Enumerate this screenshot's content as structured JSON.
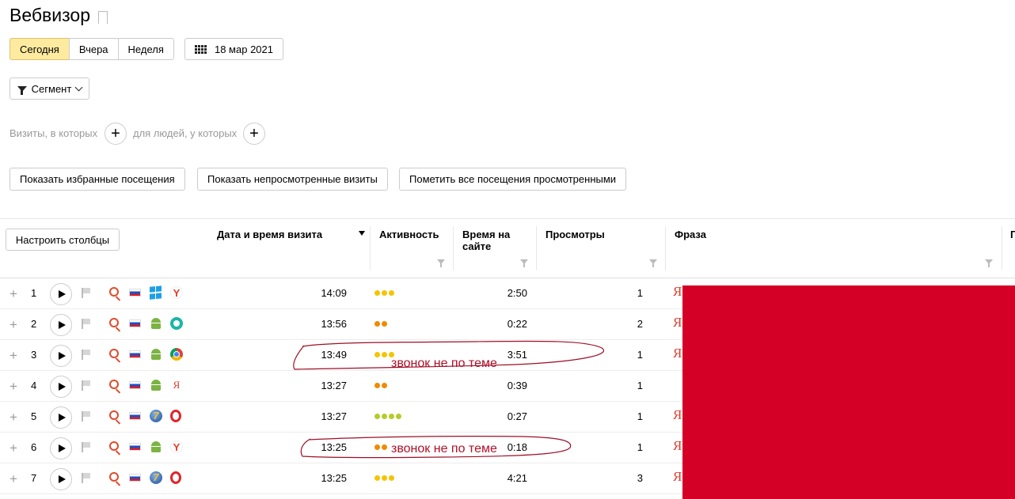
{
  "page": {
    "title": "Вебвизор"
  },
  "period": {
    "options": [
      "Сегодня",
      "Вчера",
      "Неделя"
    ],
    "active_index": 0,
    "date": "18 мар 2021"
  },
  "segment": {
    "label": "Сегмент"
  },
  "conditions": {
    "visits_label": "Визиты, в которых",
    "people_label": "для людей, у которых"
  },
  "actions": {
    "show_favorites": "Показать избранные посещения",
    "show_unviewed": "Показать непросмотренные визиты",
    "mark_all_viewed": "Пометить все посещения просмотренными"
  },
  "table": {
    "configure_columns": "Настроить столбцы",
    "headers": {
      "datetime": "Дата и время визита",
      "activity": "Активность",
      "time_on_site_1": "Время на",
      "time_on_site_2": "сайте",
      "views": "Просмотры",
      "phrase": "Фраза",
      "next_col": "П"
    },
    "rows": [
      {
        "num": "1",
        "os": "windows-icon",
        "browser": "yandex-browser-icon",
        "time": "14:09",
        "activity": 3,
        "activity_color": "#f5c400",
        "duration": "2:50",
        "views": "1",
        "phrase_icon": true
      },
      {
        "num": "2",
        "os": "android-icon",
        "browser": "teal-browser-icon",
        "time": "13:56",
        "activity": 2,
        "activity_color": "#f08a00",
        "duration": "0:22",
        "views": "2",
        "phrase_icon": true
      },
      {
        "num": "3",
        "os": "android-icon",
        "browser": "chrome-icon",
        "time": "13:49",
        "activity": 3,
        "activity_color": "#f5c400",
        "duration": "3:51",
        "views": "1",
        "phrase_icon": true
      },
      {
        "num": "4",
        "os": "android-icon",
        "browser": "yandex-icon",
        "time": "13:27",
        "activity": 2,
        "activity_color": "#f08a00",
        "duration": "0:39",
        "views": "1",
        "phrase_icon": false
      },
      {
        "num": "5",
        "os": "windows7-icon",
        "browser": "opera-icon",
        "time": "13:27",
        "activity": 4,
        "activity_color": "#b5cc2a",
        "duration": "0:27",
        "views": "1",
        "phrase_icon": true
      },
      {
        "num": "6",
        "os": "android-icon",
        "browser": "yandex-browser-icon",
        "time": "13:25",
        "activity": 2,
        "activity_color": "#f08a00",
        "duration": "0:18",
        "views": "1",
        "phrase_icon": true
      },
      {
        "num": "7",
        "os": "windows7-icon",
        "browser": "opera-icon",
        "time": "13:25",
        "activity": 3,
        "activity_color": "#f5c400",
        "duration": "4:21",
        "views": "3",
        "phrase_icon": true
      }
    ]
  },
  "annotations": {
    "note_row3": "звонок не по теме",
    "note_row6": "звонок не по теме",
    "color": "#b1102a"
  },
  "redaction_color": "#d50025"
}
